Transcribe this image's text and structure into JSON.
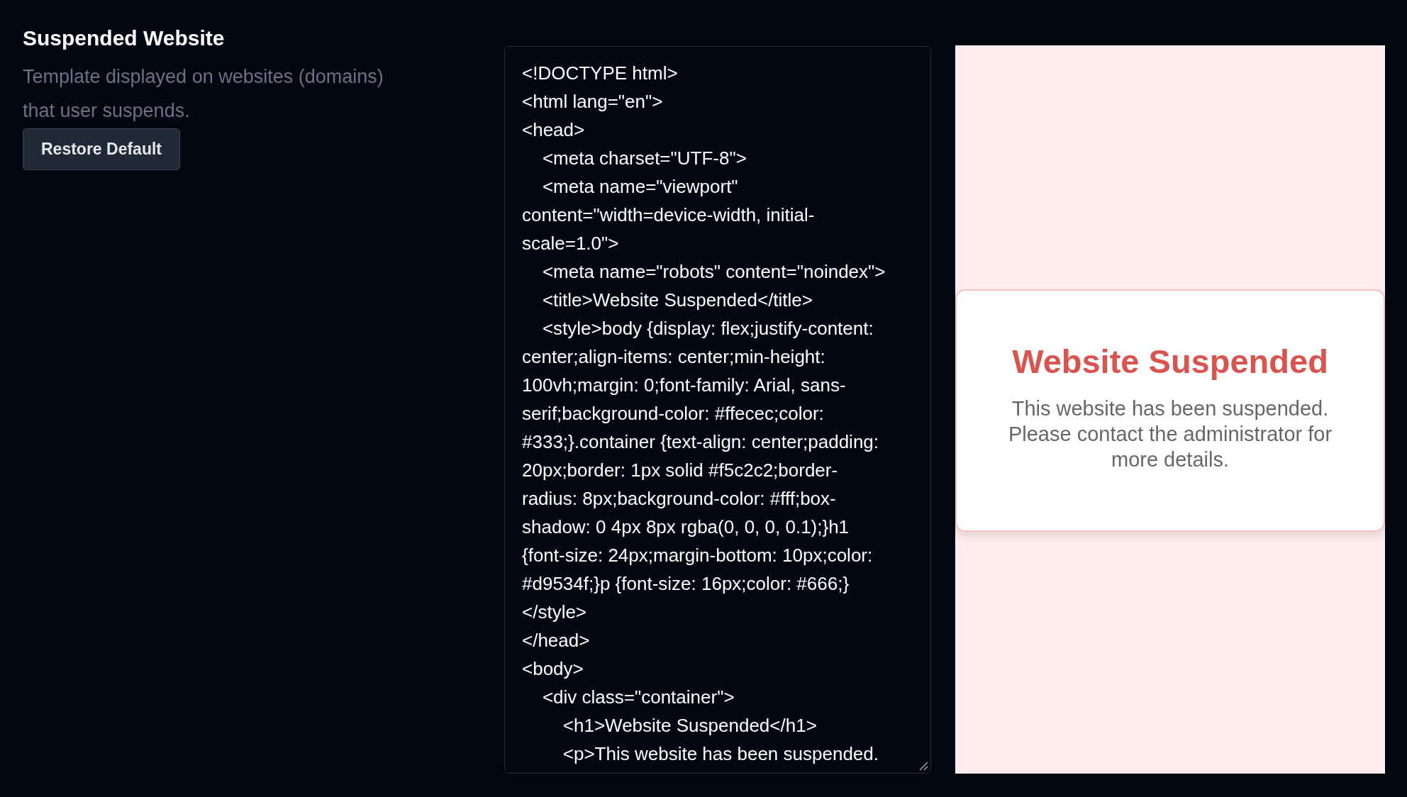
{
  "settings": {
    "title": "Suspended Website",
    "description": "Template displayed on websites (domains) that user suspends.",
    "restore_button": "Restore Default"
  },
  "editor": {
    "lines": [
      "<!DOCTYPE html>",
      "<html lang=\"en\">",
      "<head>",
      "    <meta charset=\"UTF-8\">",
      "    <meta name=\"viewport\"",
      "content=\"width=device-width, initial-",
      "scale=1.0\">",
      "    <meta name=\"robots\" content=\"noindex\">",
      "    <title>Website Suspended</title>",
      "    <style>body {display: flex;justify-content:",
      "center;align-items: center;min-height:",
      "100vh;margin: 0;font-family: Arial, sans-",
      "serif;background-color: #ffecec;color:",
      "#333;}.container {text-align: center;padding:",
      "20px;border: 1px solid #f5c2c2;border-",
      "radius: 8px;background-color: #fff;box-",
      "shadow: 0 4px 8px rgba(0, 0, 0, 0.1);}h1",
      "{font-size: 24px;margin-bottom: 10px;color:",
      "#d9534f;}p {font-size: 16px;color: #666;}",
      "</style>",
      "</head>",
      "<body>",
      "    <div class=\"container\">",
      "        <h1>Website Suspended</h1>",
      "        <p>This website has been suspended."
    ]
  },
  "preview": {
    "heading": "Website Suspended",
    "message": "This website has been suspended. Please contact the administrator for more details."
  }
}
